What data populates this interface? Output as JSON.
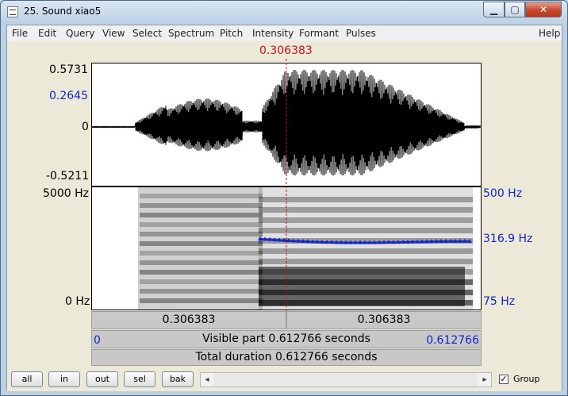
{
  "window": {
    "title": "25. Sound xiao5",
    "min_label": "▁",
    "max_label": "▢",
    "close_label": "✕"
  },
  "menu": [
    "File",
    "Edit",
    "Query",
    "View",
    "Select",
    "Spectrum",
    "Pitch",
    "Intensity",
    "Formant",
    "Pulses"
  ],
  "menu_help": "Help",
  "cursor": {
    "time_label": "0.306383"
  },
  "waveform": {
    "top": "0.5731",
    "cursor_value": "0.2645",
    "zero": "0",
    "bottom": "-0.5211"
  },
  "spectrogram": {
    "top_hz": "5000 Hz",
    "bottom_hz": "0 Hz",
    "pitch_top": "500 Hz",
    "pitch_value": "316.9 Hz",
    "pitch_bottom": "75 Hz"
  },
  "bars": {
    "left_seg": "0.306383",
    "right_seg": "0.306383",
    "visible_start": "0",
    "visible_text": "Visible part 0.612766 seconds",
    "visible_end": "0.612766",
    "total_text": "Total duration 0.612766 seconds"
  },
  "buttons": [
    "all",
    "in",
    "out",
    "sel",
    "bak"
  ],
  "scroll": {
    "left": "◂",
    "right": "▸"
  },
  "group": {
    "label": "Group",
    "checked": "✓"
  },
  "colors": {
    "cursor": "#c81414",
    "pitch": "#1326c7"
  }
}
